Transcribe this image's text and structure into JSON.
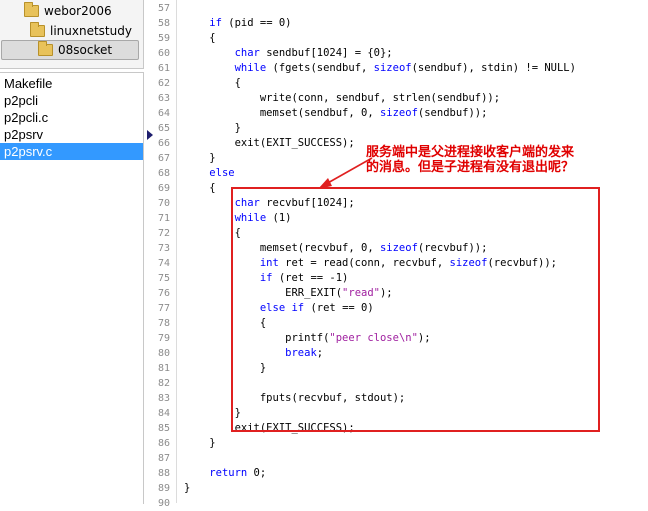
{
  "folders": [
    {
      "name": "webor2006",
      "selected": false
    },
    {
      "name": "linuxnetstudy",
      "selected": false
    },
    {
      "name": "08socket",
      "selected": true
    }
  ],
  "files": [
    {
      "name": "Makefile",
      "selected": false
    },
    {
      "name": "p2pcli",
      "selected": false
    },
    {
      "name": "p2pcli.c",
      "selected": false
    },
    {
      "name": "p2psrv",
      "selected": false
    },
    {
      "name": "p2psrv.c",
      "selected": true
    }
  ],
  "editor": {
    "lines": [
      {
        "n": "57",
        "t": ""
      },
      {
        "n": "58",
        "t": "    if (pid == 0)"
      },
      {
        "n": "59",
        "t": "    {"
      },
      {
        "n": "60",
        "t": "        char sendbuf[1024] = {0};"
      },
      {
        "n": "61",
        "t": "        while (fgets(sendbuf, sizeof(sendbuf), stdin) != NULL)"
      },
      {
        "n": "62",
        "t": "        {"
      },
      {
        "n": "63",
        "t": "            write(conn, sendbuf, strlen(sendbuf));"
      },
      {
        "n": "64",
        "t": "            memset(sendbuf, 0, sizeof(sendbuf));"
      },
      {
        "n": "65",
        "t": "        }"
      },
      {
        "n": "66",
        "t": "        exit(EXIT_SUCCESS);"
      },
      {
        "n": "67",
        "t": "    }"
      },
      {
        "n": "68",
        "t": "    else"
      },
      {
        "n": "69",
        "t": "    {"
      },
      {
        "n": "70",
        "t": "        char recvbuf[1024];"
      },
      {
        "n": "71",
        "t": "        while (1)"
      },
      {
        "n": "72",
        "t": "        {"
      },
      {
        "n": "73",
        "t": "            memset(recvbuf, 0, sizeof(recvbuf));"
      },
      {
        "n": "74",
        "t": "            int ret = read(conn, recvbuf, sizeof(recvbuf));"
      },
      {
        "n": "75",
        "t": "            if (ret == -1)"
      },
      {
        "n": "76",
        "t": "                ERR_EXIT(\"read\");"
      },
      {
        "n": "77",
        "t": "            else if (ret == 0)"
      },
      {
        "n": "78",
        "t": "            {"
      },
      {
        "n": "79",
        "t": "                printf(\"peer close\\n\");"
      },
      {
        "n": "80",
        "t": "                break;"
      },
      {
        "n": "81",
        "t": "            }"
      },
      {
        "n": "82",
        "t": ""
      },
      {
        "n": "83",
        "t": "            fputs(recvbuf, stdout);"
      },
      {
        "n": "84",
        "t": "        }"
      },
      {
        "n": "85",
        "t": "        exit(EXIT_SUCCESS);"
      },
      {
        "n": "86",
        "t": "    }"
      },
      {
        "n": "87",
        "t": ""
      },
      {
        "n": "88",
        "t": "    return 0;"
      },
      {
        "n": "89",
        "t": "}"
      },
      {
        "n": "90",
        "t": ""
      }
    ],
    "bookmark_line": "66"
  },
  "annotation": {
    "line1": "服务端中是父进程接收客户端的发来",
    "line2": "的消息。但是子进程有没有退出呢？",
    "color": "#e00000"
  },
  "colors": {
    "keyword": "#0000ff",
    "string": "#a020a0",
    "selection": "#3399ff",
    "line_number": "#8c8c8c"
  }
}
